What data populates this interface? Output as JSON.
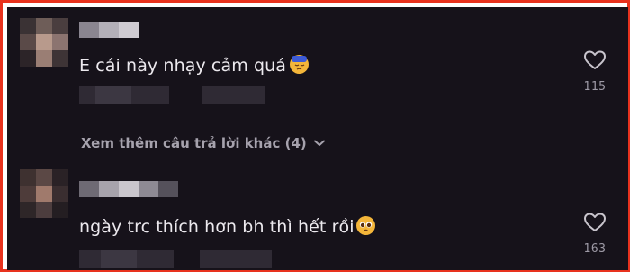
{
  "comments": [
    {
      "text": "E cái này nhạy cảm quá",
      "emoji_icon": "sleepy-face-icon",
      "likes": "115"
    },
    {
      "text": "ngày trc thích hơn bh thì hết rồi",
      "emoji_icon": "pleading-face-icon",
      "likes": "163"
    }
  ],
  "replies": {
    "label": "Xem thêm câu trả lời khác (4)",
    "icon": "chevron-down-icon"
  },
  "colors": {
    "border": "#e8321e",
    "background": "#16121a",
    "text": "#ece9ee",
    "muted": "#a6a2ad"
  }
}
